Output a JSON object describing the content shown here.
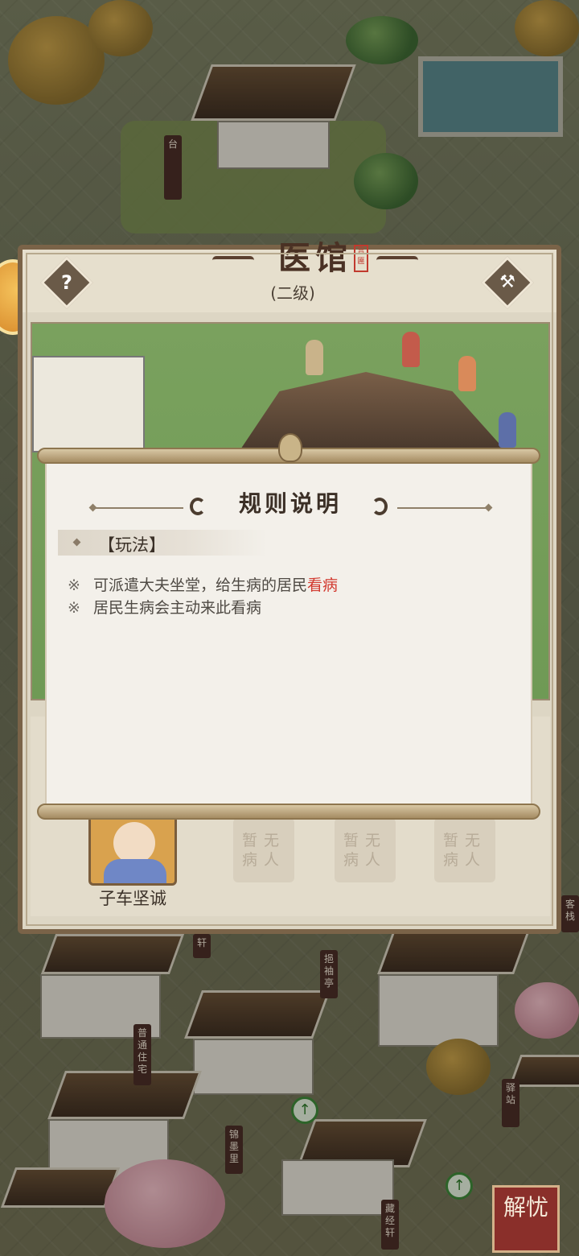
{
  "building": {
    "title": "医馆",
    "seal_text": "宫匾",
    "level": "(二级)",
    "help_label": "?",
    "build_label": "⚒"
  },
  "rules": {
    "title": "规则说明",
    "section": "【玩法】",
    "lines": [
      {
        "mark": "※",
        "text_before": "可派遣大夫坐堂，给生病的居民",
        "highlight": "看病"
      },
      {
        "mark": "※",
        "text_before": "居民生病会主动来此看病",
        "highlight": ""
      }
    ]
  },
  "doctor": {
    "name": "子车坚诚"
  },
  "empty_slots": [
    {
      "label": "暂无病人"
    },
    {
      "label": "暂无病人"
    },
    {
      "label": "暂无病人"
    }
  ],
  "map_signs": [
    "台",
    "轩",
    "挹袖亭",
    "普通住宅",
    "锦墨里",
    "藏经轩",
    "驿站",
    "客栈"
  ],
  "corner_button": {
    "label": "解忧"
  },
  "colors": {
    "highlight": "#d2392f",
    "dialog_frame": "#7a6348",
    "paper": "#f3f0ea"
  }
}
